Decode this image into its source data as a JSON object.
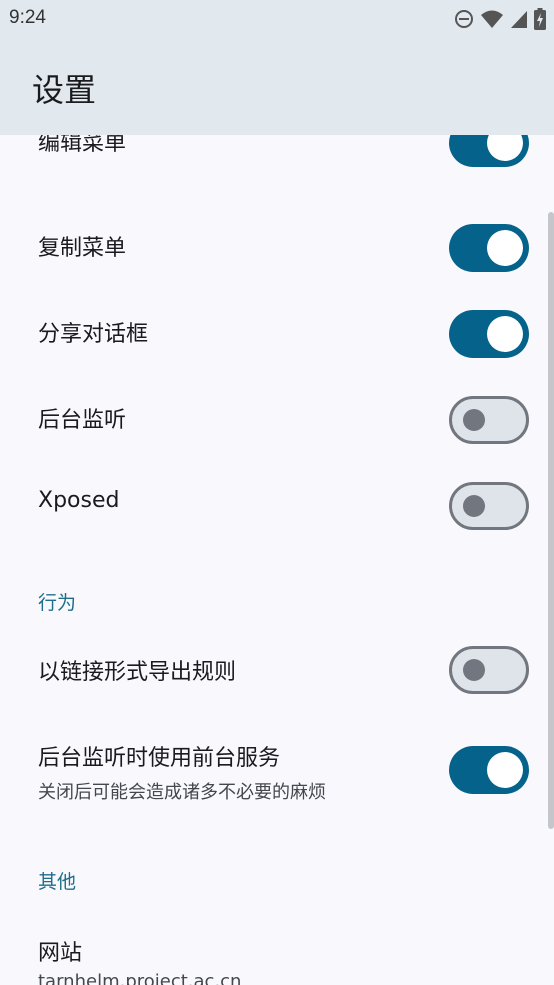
{
  "status": {
    "time": "9:24",
    "icons": [
      "do-not-disturb-icon",
      "wifi-icon",
      "signal-icon",
      "battery-charging-icon"
    ]
  },
  "app": {
    "title": "设置"
  },
  "display_items": [
    {
      "title": "编辑菜单",
      "checked": true
    },
    {
      "title": "复制菜单",
      "checked": true
    },
    {
      "title": "分享对话框",
      "checked": true
    },
    {
      "title": "后台监听",
      "checked": false
    },
    {
      "title": "Xposed",
      "checked": false
    }
  ],
  "behavior": {
    "header": "行为",
    "export_as_link": {
      "title": "以链接形式导出规则",
      "checked": false
    },
    "foreground_service": {
      "title": "后台监听时使用前台服务",
      "summary": "关闭后可能会造成诸多不必要的麻烦",
      "checked": true
    }
  },
  "other": {
    "header": "其他",
    "website": {
      "title": "网站",
      "summary": "tarnhelm.project.ac.cn"
    }
  },
  "colors": {
    "accent": "#05638b",
    "header_bg": "#e1e9ef",
    "section_header": "#1e6e8a",
    "background": "#f9f9fd"
  }
}
